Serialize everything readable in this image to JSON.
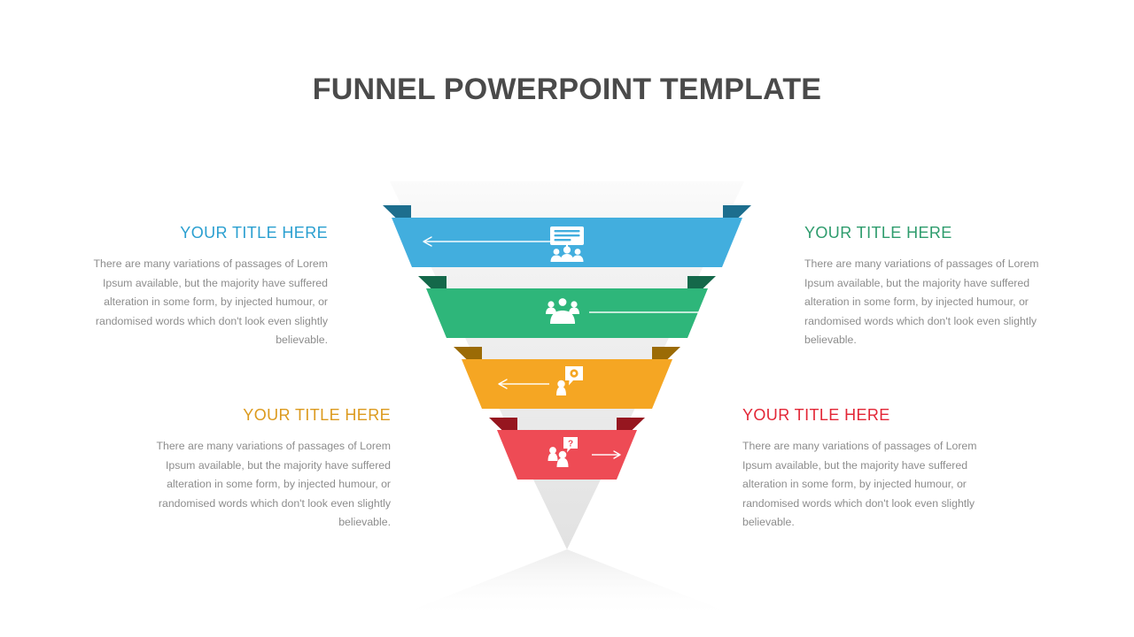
{
  "slide": {
    "title": "FUNNEL POWERPOINT TEMPLATE",
    "background": "#ffffff"
  },
  "body_text": "There are many variations of passages of Lorem Ipsum available, but the majority have suffered alteration in some form, by injected humour, or randomised words which don't look even slightly believable.",
  "text_blocks": [
    {
      "title": "YOUR TITLE HERE",
      "title_color": "#2a9fd0",
      "align": "right",
      "body": "There are many variations of passages of Lorem Ipsum available, but the majority have suffered alteration in some form, by injected humour, or randomised words which don't look even slightly believable."
    },
    {
      "title": "YOUR TITLE HERE",
      "title_color": "#2e9c6d",
      "align": "left",
      "body": "There are many variations of passages of Lorem Ipsum available, but the majority have suffered alteration in some form, by injected humour, or randomised words which don't look even slightly believable."
    },
    {
      "title": "YOUR TITLE HERE",
      "title_color": "#dc9a1e",
      "align": "right",
      "body": "There are many variations of passages of Lorem Ipsum available, but the majority have suffered alteration in some form, by injected humour, or randomised words which don't look even slightly believable."
    },
    {
      "title": "YOUR TITLE HERE",
      "title_color": "#e32636",
      "align": "left",
      "body": "There are many variations of passages of Lorem Ipsum available, but the majority have suffered alteration in some form, by injected humour, or randomised words which don't look even slightly believable."
    }
  ],
  "funnel": {
    "backdrop_color": "#ededed",
    "backdrop_top_color": "#fafafa",
    "bands": [
      {
        "name": "band-blue",
        "color": "#42aede",
        "fold_color": "#1d6e8e",
        "icon": "presentation-audience-icon",
        "arrow": "arrow-left",
        "arrow_color": "#ffffff"
      },
      {
        "name": "band-green",
        "color": "#2eb67a",
        "fold_color": "#14684a",
        "icon": "group-people-icon",
        "arrow": "arrow-right",
        "arrow_color": "#ffffff"
      },
      {
        "name": "band-orange",
        "color": "#f5a623",
        "fold_color": "#9b6b06",
        "icon": "person-speech-bubble-icon",
        "arrow": "arrow-left",
        "arrow_color": "#ffffff"
      },
      {
        "name": "band-red",
        "color": "#ee4b55",
        "fold_color": "#96161f",
        "icon": "people-question-bubble-icon",
        "arrow": "arrow-right",
        "arrow_color": "#ffffff"
      }
    ]
  }
}
